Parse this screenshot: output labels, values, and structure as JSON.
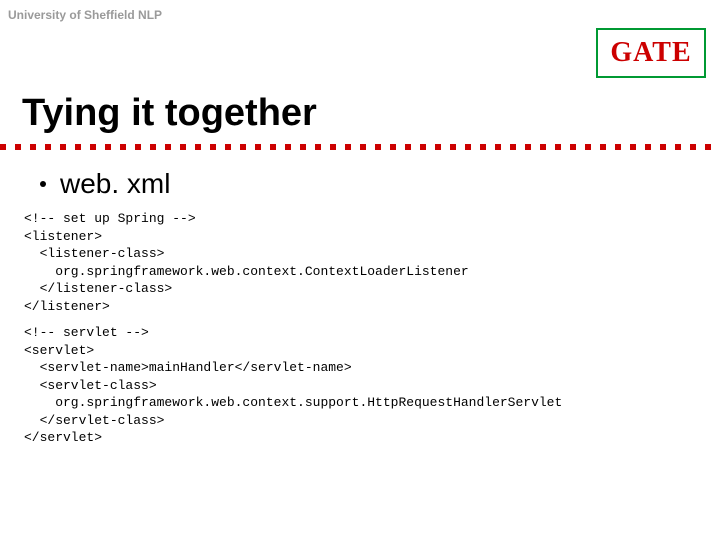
{
  "header": {
    "affiliation": "University of Sheffield NLP",
    "logo_text": "GATE"
  },
  "title": "Tying it together",
  "bullet": {
    "label": "web. xml"
  },
  "code": {
    "block1": "<!-- set up Spring -->\n<listener>\n  <listener-class>\n    org.springframework.web.context.ContextLoaderListener\n  </listener-class>\n</listener>",
    "block2": "<!-- servlet -->\n<servlet>\n  <servlet-name>mainHandler</servlet-name>\n  <servlet-class>\n    org.springframework.web.context.support.HttpRequestHandlerServlet\n  </servlet-class>\n</servlet>"
  }
}
